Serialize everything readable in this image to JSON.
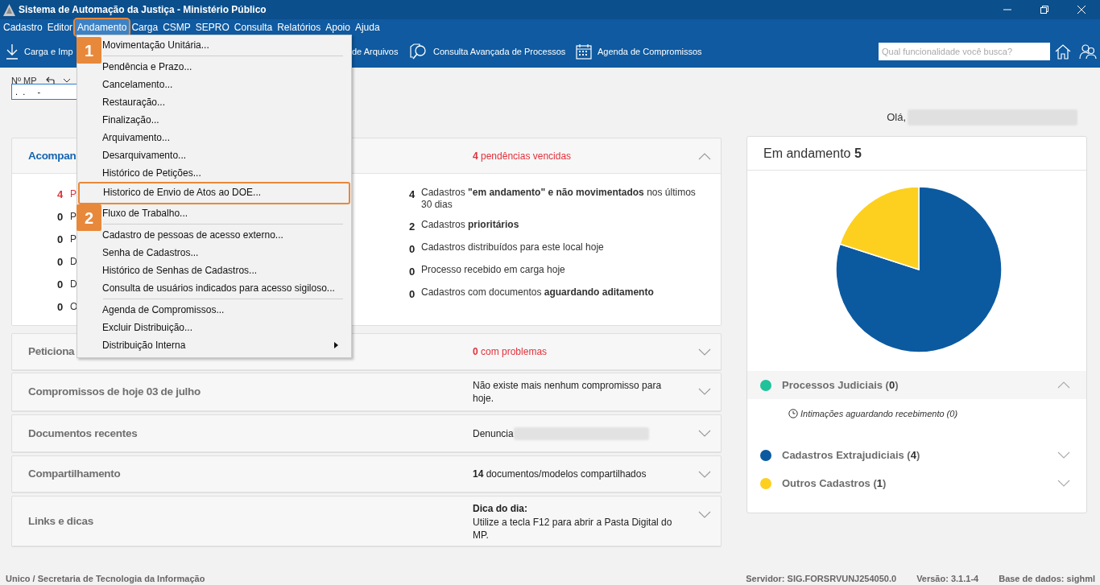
{
  "window": {
    "title": "Sistema de Automação da Justiça - Ministério Público"
  },
  "menu_bar": [
    {
      "label": "Cadastro",
      "selected": false,
      "highlighted": false
    },
    {
      "label": "Editor",
      "selected": false,
      "highlighted": false
    },
    {
      "label": "Andamento",
      "selected": true,
      "highlighted": true
    },
    {
      "label": "Carga",
      "selected": false,
      "highlighted": false
    },
    {
      "label": "CSMP",
      "selected": false,
      "highlighted": false
    },
    {
      "label": "SEPRO",
      "selected": false,
      "highlighted": false
    },
    {
      "label": "Consulta",
      "selected": false,
      "highlighted": false
    },
    {
      "label": "Relatórios",
      "selected": false,
      "highlighted": false
    },
    {
      "label": "Apoio",
      "selected": false,
      "highlighted": false
    },
    {
      "label": "Ajuda",
      "selected": false,
      "highlighted": false
    }
  ],
  "toolbar": {
    "items": [
      {
        "label": "Carga e Imp",
        "kind": "download"
      },
      {
        "label": "de Arquivos",
        "kind": "none"
      },
      {
        "label": "Consulta Avançada de Processos",
        "kind": "search-doc"
      },
      {
        "label": "Agenda de Compromissos",
        "kind": "calendar"
      }
    ],
    "search": {
      "placeholder": "Qual funcionalidade você busca?"
    }
  },
  "dropdown": {
    "groups": [
      {
        "items": [
          {
            "label": "Movimentação Unitária...",
            "highlighted": false,
            "submenu": false
          }
        ]
      },
      {
        "items": [
          {
            "label": "Pendência e Prazo...",
            "highlighted": false,
            "submenu": false
          },
          {
            "label": "Cancelamento...",
            "highlighted": false,
            "submenu": false
          },
          {
            "label": "Restauração...",
            "highlighted": false,
            "submenu": false
          },
          {
            "label": "Finalização...",
            "highlighted": false,
            "submenu": false
          },
          {
            "label": "Arquivamento...",
            "highlighted": false,
            "submenu": false
          },
          {
            "label": "Desarquivamento...",
            "highlighted": false,
            "submenu": false
          },
          {
            "label": "Histórico de Petições...",
            "highlighted": false,
            "submenu": false
          },
          {
            "label": "Historico de Envio de Atos ao DOE...",
            "highlighted": true,
            "submenu": false
          },
          {
            "label": "Fluxo de Trabalho...",
            "highlighted": false,
            "submenu": false
          }
        ]
      },
      {
        "items": [
          {
            "label": "Cadastro de pessoas de acesso externo...",
            "highlighted": false,
            "submenu": false
          },
          {
            "label": "Senha de Cadastros...",
            "highlighted": false,
            "submenu": false
          },
          {
            "label": "Histórico de Senhas de Cadastros...",
            "highlighted": false,
            "submenu": false
          },
          {
            "label": "Consulta de usuários indicados para acesso sigiloso...",
            "highlighted": false,
            "submenu": false
          }
        ]
      },
      {
        "items": [
          {
            "label": "Agenda de Compromissos...",
            "highlighted": false,
            "submenu": false
          },
          {
            "label": "Excluir Distribuição...",
            "highlighted": false,
            "submenu": false
          },
          {
            "label": "Distribuição Interna",
            "highlighted": false,
            "submenu": true
          }
        ]
      }
    ]
  },
  "annotations": [
    {
      "label": "1"
    },
    {
      "label": "2"
    }
  ],
  "mp_field": {
    "label": "Nº MP",
    "value": ".  .     -"
  },
  "greeting": "Olá,",
  "panels": [
    {
      "title": "Acompan",
      "expanded": true,
      "alert": true,
      "summary": "**4** pendências vencidas",
      "left_items": [
        {
          "count": "4",
          "label": "P",
          "alert": true
        },
        {
          "count": "0",
          "label": "P",
          "alert": false
        },
        {
          "count": "0",
          "label": "P",
          "alert": false
        },
        {
          "count": "0",
          "label": "D",
          "alert": false
        },
        {
          "count": "0",
          "label": "D",
          "alert": false
        },
        {
          "count": "0",
          "label": "O",
          "alert": false
        }
      ],
      "right_items": [
        {
          "count": "4",
          "text": "Cadastros **\"em andamento\" e não movimentados** nos últimos 30 dias"
        },
        {
          "count": "2",
          "text": "Cadastros **prioritários**"
        },
        {
          "count": "0",
          "text": "Cadastros distribuídos para este local hoje"
        },
        {
          "count": "0",
          "text": "Processo recebido em carga hoje"
        },
        {
          "count": "0",
          "text": "Cadastros com documentos **aguardando aditamento**"
        }
      ]
    },
    {
      "title": "Peticiona",
      "expanded": false,
      "alert": true,
      "summary": "**0** com problemas"
    },
    {
      "title": "Compromissos de hoje 03 de julho",
      "expanded": false,
      "alert": false,
      "summary": "Não existe mais nenhum compromisso para hoje."
    },
    {
      "title": "Documentos recentes",
      "expanded": false,
      "alert": false,
      "summary": "Denuncia",
      "redacted": true
    },
    {
      "title": "Compartilhamento",
      "expanded": false,
      "alert": false,
      "summary": "**14** documentos/modelos compartilhados"
    },
    {
      "title": "Links e dicas",
      "expanded": false,
      "alert": false,
      "heading": "Dica do dia:",
      "summary": "Utilize a tecla F12 para abrir a Pasta Digital do MP."
    }
  ],
  "status_panel": {
    "title": "Em andamento **5**",
    "chart_data": {
      "type": "pie",
      "series": [
        {
          "values": [
            0,
            80,
            20
          ]
        }
      ]
    },
    "legend": [
      {
        "label": "Processos Judiciais (**0**)",
        "color": "#20c29a",
        "expanded": true,
        "children": [
          {
            "label": "Intimações aguardando recebimento (0)"
          }
        ]
      },
      {
        "label": "Cadastros Extrajudiciais (**4**)",
        "color": "#0b5aa0",
        "expanded": false
      },
      {
        "label": "Outros Cadastros (**1**)",
        "color": "#fdd020",
        "expanded": false
      }
    ]
  },
  "status_bar": {
    "left": "Unico / Secretaria de Tecnologia da Informação",
    "right": [
      "Servidor: SIG.FORSRVUNJ254050.0",
      "Versão: 3.1.1-4",
      "Base de dados: sighml"
    ]
  }
}
